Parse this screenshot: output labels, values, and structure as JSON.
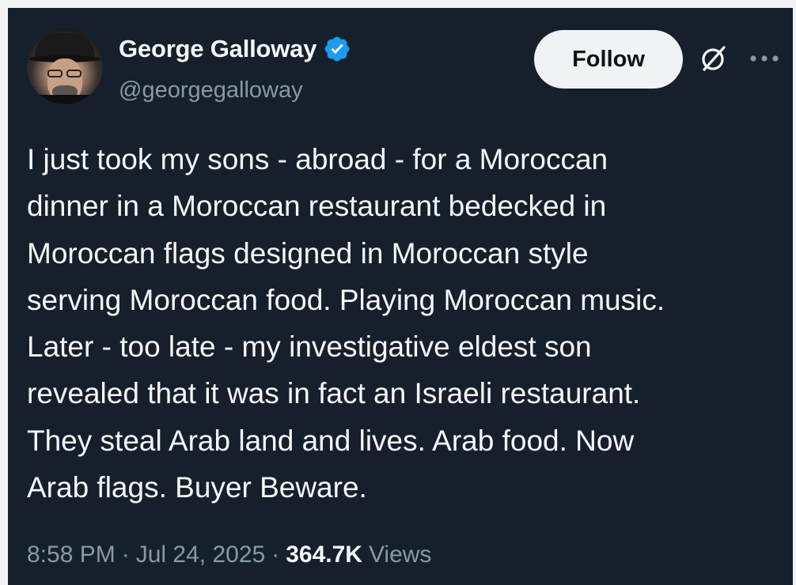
{
  "tweet": {
    "author": {
      "display_name": "George Galloway",
      "handle": "@georgegalloway",
      "verified": true,
      "verified_icon": "verified-badge-icon",
      "verified_color": "#1d9bf0"
    },
    "follow_label": "Follow",
    "icons": {
      "grok": "grok-icon",
      "more": "more-options-icon"
    },
    "text": "I just took my sons - abroad - for a Moroccan\ndinner in a Moroccan restaurant bedecked in\nMoroccan flags designed in Moroccan style\nserving Moroccan food. Playing Moroccan music.\nLater - too late - my investigative eldest son\nrevealed that it was in fact an Israeli restaurant.\nThey steal Arab land and lives. Arab food. Now\nArab flags. Buyer Beware.",
    "time": "8:58 PM",
    "date": "Jul 24, 2025",
    "separator": "·",
    "views_count": "364.7K",
    "views_label": "Views"
  },
  "colors": {
    "background": "#16202c",
    "text_primary": "#f5f8fa",
    "text_secondary": "#8899a6",
    "follow_bg": "#eff3f4"
  }
}
